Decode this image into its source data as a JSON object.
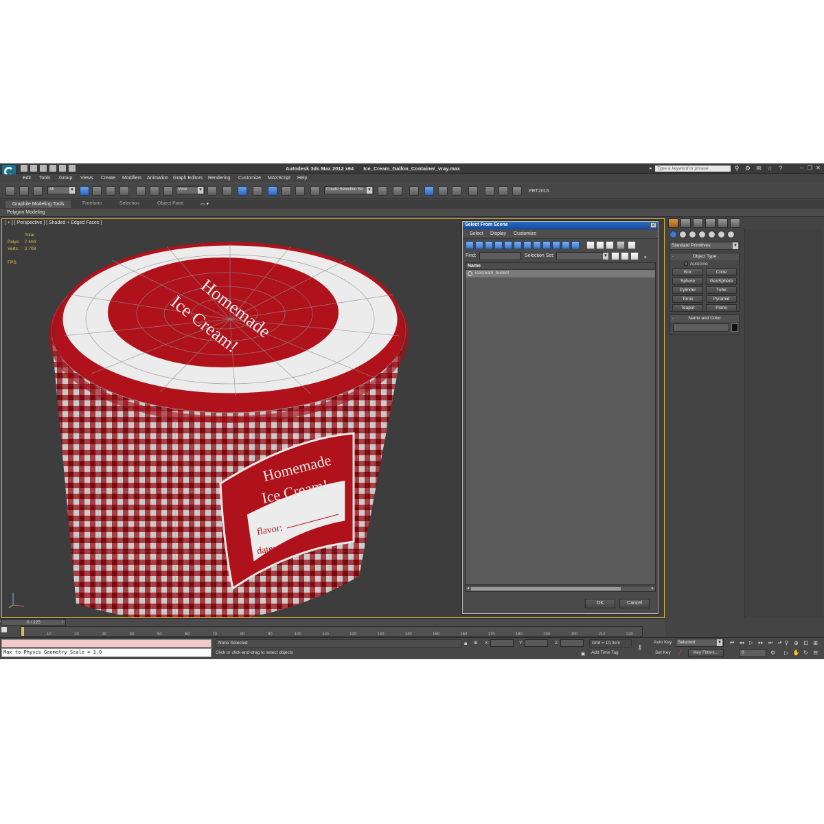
{
  "title_bar": {
    "app": "Autodesk 3ds Max  2012 x64",
    "file": "Ice_Cream_Gallon_Container_vray.max",
    "search_placeholder": "Type a keyword or phrase"
  },
  "menu": [
    "Edit",
    "Tools",
    "Group",
    "Views",
    "Create",
    "Modifiers",
    "Animation",
    "Graph Editors",
    "Rendering",
    "Customize",
    "MAXScript",
    "Help"
  ],
  "toolbar": {
    "filter_value": "All",
    "ref_coord": "View",
    "selection_set_placeholder": "Create Selection Se",
    "snap_value": "3",
    "render_label": "PRT2016"
  },
  "ribbon": {
    "tabs": [
      "Graphite Modeling Tools",
      "Freeform",
      "Selection",
      "Object Paint"
    ],
    "subtab": "Polygon Modeling"
  },
  "viewport": {
    "label": "[ + ] [ Perspective ] [ Shaded + Edged Faces ]",
    "stats_header": "Total",
    "polys_label": "Polys:",
    "polys_value": "7 404",
    "verts_label": "Verts:",
    "verts_value": "3 708",
    "fps_label": "FPS:"
  },
  "model": {
    "lid_line1": "Homemade",
    "lid_line2": "Ice Cream!",
    "label_line1": "Homemade",
    "label_line2": "Ice Cream!",
    "flavor": "flavor:",
    "date": "date:",
    "colors": {
      "red": "#b0121b",
      "white": "#e9e9e9",
      "wire": "#8e8e8e"
    }
  },
  "dialog": {
    "title": "Select From Scene",
    "menu": [
      "Select",
      "Display",
      "Customize"
    ],
    "find_label": "Find:",
    "selset_label": "Selection Set:",
    "column_name": "Name",
    "rows": [
      "icecream_bucket"
    ],
    "ok": "OK",
    "cancel": "Cancel"
  },
  "command_panel": {
    "category": "Standard Primitives",
    "object_type_title": "Object Type",
    "autogrid": "AutoGrid",
    "primitives": [
      "Box",
      "Cone",
      "Sphere",
      "GeoSphere",
      "Cylinder",
      "Tube",
      "Torus",
      "Pyramid",
      "Teapot",
      "Plane"
    ],
    "name_color_title": "Name and Color"
  },
  "timeline": {
    "frame_display": "0 / 225",
    "current_frame": 0,
    "total_frames": 225,
    "ticks": [
      0,
      10,
      20,
      30,
      40,
      50,
      60,
      70,
      80,
      90,
      100,
      110,
      120,
      130,
      140,
      150,
      160,
      170,
      180,
      190,
      200,
      210,
      220
    ]
  },
  "status": {
    "maxscript_output": "Max to Physcs Geometry Scale = 1.0",
    "selection": "None Selected",
    "prompt": "Click or click-and-drag to select objects",
    "x_label": "X:",
    "y_label": "Y:",
    "z_label": "Z:",
    "grid": "Grid = 10,0cm",
    "add_time_tag": "Add Time Tag",
    "auto_key": "Auto Key",
    "set_key": "Set Key",
    "key_mode": "Selected",
    "key_filters": "Key Filters...",
    "frame": "0"
  }
}
